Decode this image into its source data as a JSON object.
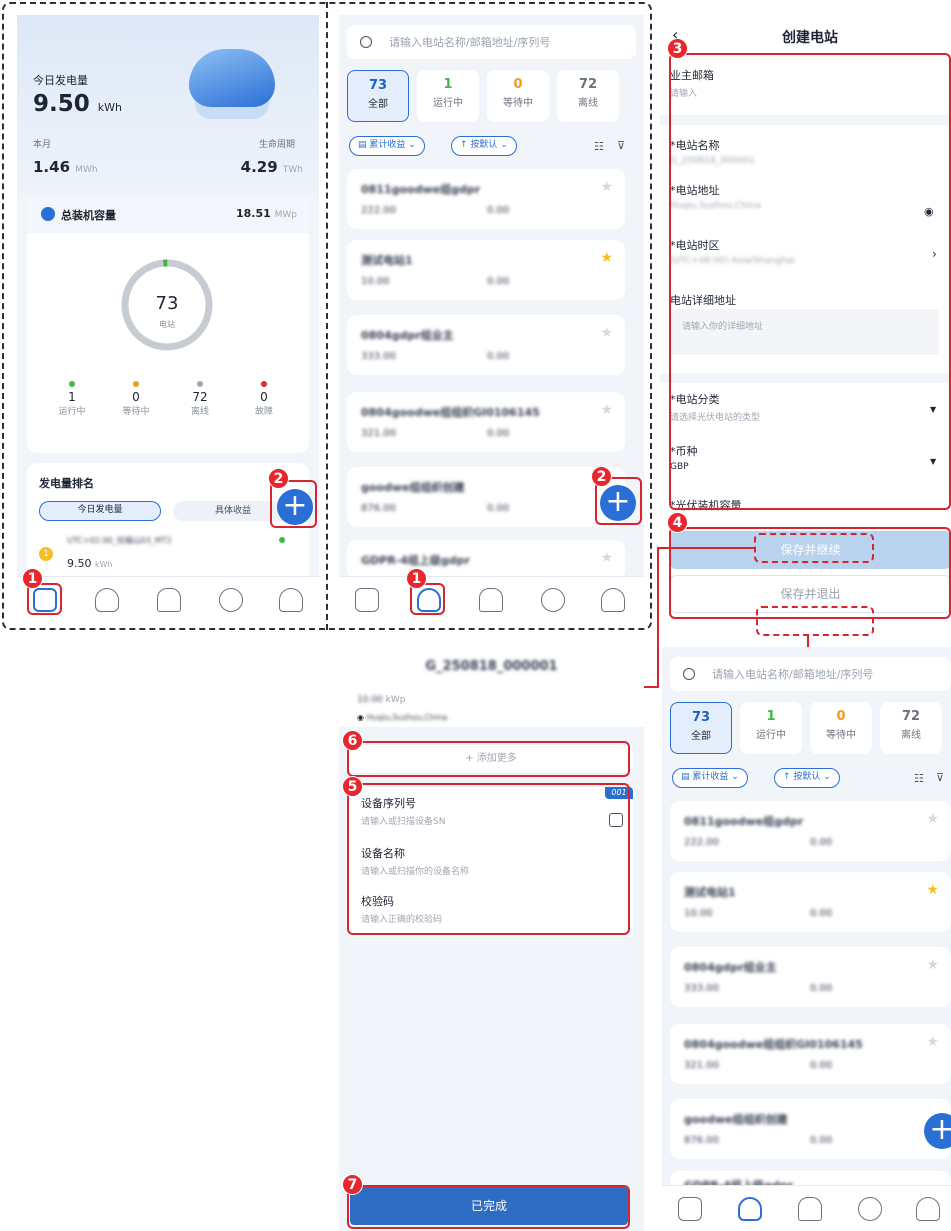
{
  "markers": {
    "m1": "1",
    "m2": "2",
    "m3": "3",
    "m4": "4",
    "m5": "5",
    "m6": "6",
    "m7": "7"
  },
  "home": {
    "today_label": "今日发电量",
    "today_value": "9.50",
    "today_unit": "kWh",
    "month_label": "本月",
    "month_value": "1.46",
    "month_unit": "MWh",
    "life_label": "生命周期",
    "life_value": "4.29",
    "life_unit": "TWh",
    "capacity_label": "总装机容量",
    "capacity_value": "18.51",
    "capacity_unit": "MWp",
    "ring_value": "73",
    "ring_label": "电站",
    "status": [
      {
        "value": "1",
        "label": "运行中",
        "color": "#3fb83f"
      },
      {
        "value": "0",
        "label": "等待中",
        "color": "#f39a1e"
      },
      {
        "value": "72",
        "label": "离线",
        "color": "#a0a6b0"
      },
      {
        "value": "0",
        "label": "故障",
        "color": "#e8262d"
      }
    ],
    "rank_title": "发电量排名",
    "rank_tab_today": "今日发电量",
    "rank_tab_income": "具体收益",
    "rank_item_name": "UTC+02:00_培福山03_MT2",
    "rank_item_value": "9.50",
    "rank_item_unit": "kWh",
    "rank_badge": "1"
  },
  "list": {
    "search_placeholder": "请输入电站名称/邮箱地址/序列号",
    "stats": [
      {
        "value": "73",
        "label": "全部"
      },
      {
        "value": "1",
        "label": "运行中"
      },
      {
        "value": "0",
        "label": "等待中"
      },
      {
        "value": "72",
        "label": "离线"
      }
    ],
    "filter1": "累计收益",
    "filter2": "按默认",
    "stations": [
      {
        "name": "0811goodwe组gdpr",
        "cap": "222.00",
        "income": "0.00"
      },
      {
        "name": "测试电站1",
        "cap": "10.00",
        "income": "0.00"
      },
      {
        "name": "0804gdpr组业主",
        "cap": "333.00",
        "income": "0.00"
      },
      {
        "name": "0804goodwe组组织GI0106145",
        "cap": "321.00",
        "income": "0.00"
      },
      {
        "name": "goodwe组组织创建",
        "cap": "876.00",
        "income": "0.00"
      },
      {
        "name": "GDPR-4组上级gdpr",
        "cap": "",
        "income": ""
      }
    ]
  },
  "create": {
    "title": "创建电站",
    "owner_email_label": "业主邮箱",
    "owner_email_placeholder": "请输入",
    "name_label": "*电站名称",
    "name_value": "G_250818_000001",
    "address_label": "*电站地址",
    "address_value": "Huqiu,Suzhou,China",
    "timezone_label": "*电站时区",
    "timezone_value": "(UTC+08:00) Asia/Shanghai",
    "detail_label": "电站详细地址",
    "detail_placeholder": "请输入你的详细地址",
    "category_label": "*电站分类",
    "category_placeholder": "请选择光伏电站的类型",
    "currency_label": "*币种",
    "currency_value": "GBP",
    "pv_label": "*光伏装机容量",
    "save_continue": "保存并继续",
    "save_exit": "保存并退出"
  },
  "device": {
    "station_name": "G_250818_000001",
    "capacity": "10.00",
    "capacity_unit": "kWp",
    "address": "Huqiu,Suzhou,China",
    "add_more": "+ 添加更多",
    "badge": "001",
    "sn_label": "设备序列号",
    "sn_placeholder": "请输入或扫描设备SN",
    "dname_label": "设备名称",
    "dname_placeholder": "请输入或扫描你的设备名称",
    "code_label": "校验码",
    "code_placeholder": "请输入正确的校验码",
    "done": "已完成"
  }
}
